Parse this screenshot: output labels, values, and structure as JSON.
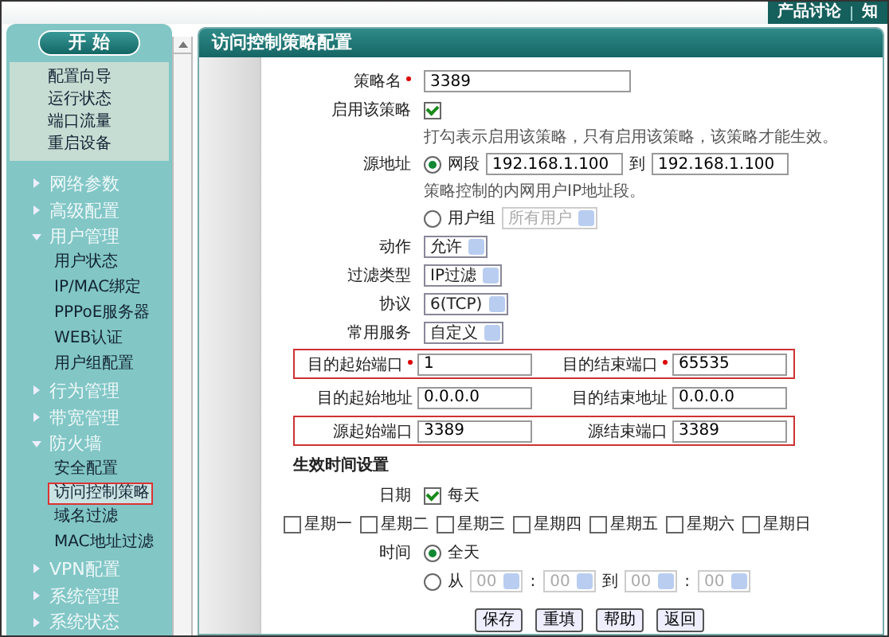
{
  "top_links": [
    "产品讨论",
    "知"
  ],
  "sidebar": {
    "start_button": "开 始",
    "quick_links": [
      "配置向导",
      "运行状态",
      "端口流量",
      "重启设备"
    ],
    "groups": [
      {
        "label": "网络参数",
        "expanded": false
      },
      {
        "label": "高级配置",
        "expanded": false
      },
      {
        "label": "用户管理",
        "expanded": true,
        "children": [
          {
            "label": "用户状态",
            "selected": false
          },
          {
            "label": "IP/MAC绑定",
            "selected": false
          },
          {
            "label": "PPPoE服务器",
            "selected": false
          },
          {
            "label": "WEB认证",
            "selected": false
          },
          {
            "label": "用户组配置",
            "selected": false
          }
        ]
      },
      {
        "label": "行为管理",
        "expanded": false
      },
      {
        "label": "带宽管理",
        "expanded": false
      },
      {
        "label": "防火墙",
        "expanded": true,
        "children": [
          {
            "label": "安全配置",
            "selected": false
          },
          {
            "label": "访问控制策略",
            "selected": true
          },
          {
            "label": "域名过滤",
            "selected": false
          },
          {
            "label": "MAC地址过滤",
            "selected": false
          }
        ]
      },
      {
        "label": "VPN配置",
        "expanded": false
      },
      {
        "label": "系统管理",
        "expanded": false
      },
      {
        "label": "系统状态",
        "expanded": false
      }
    ]
  },
  "page_title": "访问控制策略配置",
  "policy_name": {
    "label": "策略名",
    "required": true,
    "value": "3389"
  },
  "enable": {
    "label": "启用该策略",
    "checked": true,
    "hint": "打勾表示启用该策略，只有启用该策略，该策略才能生效。"
  },
  "source": {
    "label": "源地址",
    "segment": {
      "label": "网段",
      "selected": true,
      "from": "192.168.1.100",
      "to_label": "到",
      "to": "192.168.1.100"
    },
    "hint": "策略控制的内网用户IP地址段。",
    "group": {
      "label": "用户组",
      "selected": false,
      "value": "所有用户",
      "disabled": true
    }
  },
  "selects": [
    {
      "label": "动作",
      "value": "允许"
    },
    {
      "label": "过滤类型",
      "value": "IP过滤"
    },
    {
      "label": "协议",
      "value": "6(TCP)"
    },
    {
      "label": "常用服务",
      "value": "自定义"
    }
  ],
  "pairs": [
    {
      "highlighted": true,
      "left": {
        "label": "目的起始端口",
        "required": true,
        "value": "1"
      },
      "right": {
        "label": "目的结束端口",
        "required": true,
        "value": "65535"
      }
    },
    {
      "highlighted": false,
      "left": {
        "label": "目的起始地址",
        "required": false,
        "value": "0.0.0.0"
      },
      "right": {
        "label": "目的结束地址",
        "required": false,
        "value": "0.0.0.0"
      }
    },
    {
      "highlighted": true,
      "left": {
        "label": "源起始端口",
        "required": false,
        "value": "3389"
      },
      "right": {
        "label": "源结束端口",
        "required": false,
        "value": "3389"
      }
    }
  ],
  "schedule": {
    "title": "生效时间设置",
    "date_label": "日期",
    "everyday": {
      "label": "每天",
      "checked": true
    },
    "weekdays": [
      {
        "label": "星期一",
        "checked": false
      },
      {
        "label": "星期二",
        "checked": false
      },
      {
        "label": "星期三",
        "checked": false
      },
      {
        "label": "星期四",
        "checked": false
      },
      {
        "label": "星期五",
        "checked": false
      },
      {
        "label": "星期六",
        "checked": false
      },
      {
        "label": "星期日",
        "checked": false
      }
    ],
    "time_label": "时间",
    "all_day": {
      "label": "全天",
      "selected": true
    },
    "range": {
      "label": "从",
      "selected": false,
      "disabled": true,
      "start_hour": "00",
      "start_minute": "00",
      "to_label": "到",
      "end_hour": "00",
      "end_minute": "00",
      "separator": ":"
    }
  },
  "buttons": [
    "保存",
    "重填",
    "帮助",
    "返回"
  ]
}
